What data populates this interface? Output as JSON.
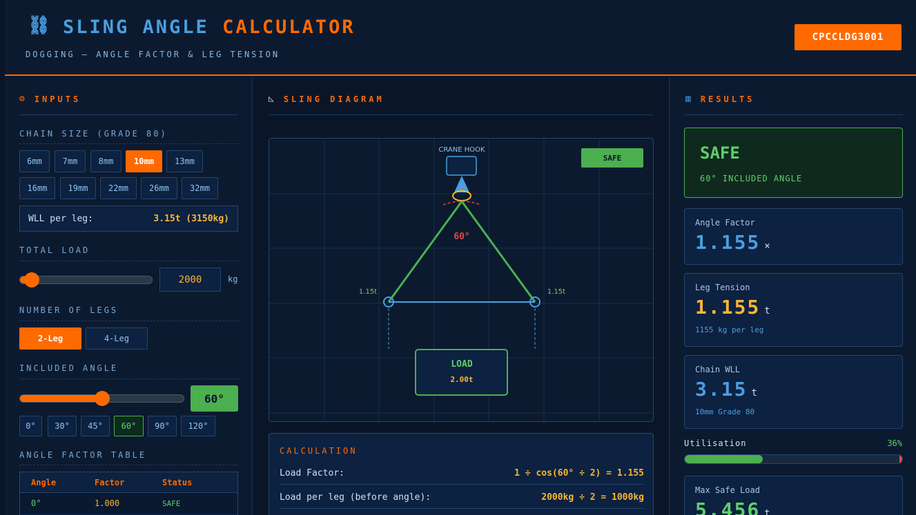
{
  "header": {
    "icon": "chain-icon",
    "title_main": "SLING ANGLE ",
    "title_accent": "CALCULATOR",
    "subtitle": "DOGGING — ANGLE FACTOR & LEG TENSION",
    "code": "CPCCLDG3001"
  },
  "colors": {
    "accent": "#ff6a00",
    "blue": "#4a9fe0",
    "green": "#4caf50",
    "yellow": "#f7b733",
    "red": "#e84545",
    "bg": "#0a1628"
  },
  "inputs": {
    "title": "INPUTS",
    "chain_label": "CHAIN SIZE (GRADE 80)",
    "chain_sizes": [
      "6mm",
      "7mm",
      "8mm",
      "10mm",
      "13mm",
      "16mm",
      "19mm",
      "22mm",
      "26mm",
      "32mm"
    ],
    "chain_selected": "10mm",
    "wll_label": "WLL per leg:",
    "wll_value": "3.15t (3150kg)",
    "load_label": "TOTAL LOAD",
    "load_value": "2000",
    "load_unit": "kg",
    "load_slider_fraction": 0.09,
    "legs_label": "NUMBER OF LEGS",
    "legs": [
      "2-Leg",
      "4-Leg"
    ],
    "legs_selected": "2-Leg",
    "angle_label": "INCLUDED ANGLE",
    "angle_value": "60°",
    "angle_slider_fraction": 0.5,
    "angle_presets": [
      "0°",
      "30°",
      "45°",
      "60°",
      "90°",
      "120°"
    ],
    "angle_selected": "60°",
    "table_label": "ANGLE FACTOR TABLE",
    "table_headers": [
      "Angle",
      "Factor",
      "Status"
    ],
    "table_rows": [
      [
        "0°",
        "1.000",
        "SAFE"
      ]
    ]
  },
  "diagram": {
    "title": "SLING DIAGRAM",
    "hook_label": "CRANE HOOK",
    "status": "SAFE",
    "angle": "60°",
    "leg_left": "1.15t",
    "leg_right": "1.15t",
    "load_title": "LOAD",
    "load_value": "2.00t"
  },
  "calculation": {
    "title": "CALCULATION",
    "rows": [
      {
        "k": "Load Factor:",
        "v": "1 ÷ cos(60° ÷ 2) = 1.155"
      },
      {
        "k": "Load per leg (before angle):",
        "v": "2000kg ÷ 2 = 1000kg"
      }
    ]
  },
  "results": {
    "title": "RESULTS",
    "status": "SAFE",
    "status_note": "60° INCLUDED ANGLE",
    "angle_factor_label": "Angle Factor",
    "angle_factor_value": "1.155",
    "angle_factor_unit": "×",
    "leg_tension_label": "Leg Tension",
    "leg_tension_value": "1.155",
    "leg_tension_unit": "t",
    "leg_tension_note": "1155 kg per leg",
    "chain_wll_label": "Chain WLL",
    "chain_wll_value": "3.15",
    "chain_wll_unit": "t",
    "chain_wll_note": "10mm Grade 80",
    "util_label": "Utilisation",
    "util_pct": "36%",
    "util_fraction": 0.36,
    "max_label": "Max Safe Load",
    "max_value": "5.456",
    "max_unit": "t"
  }
}
